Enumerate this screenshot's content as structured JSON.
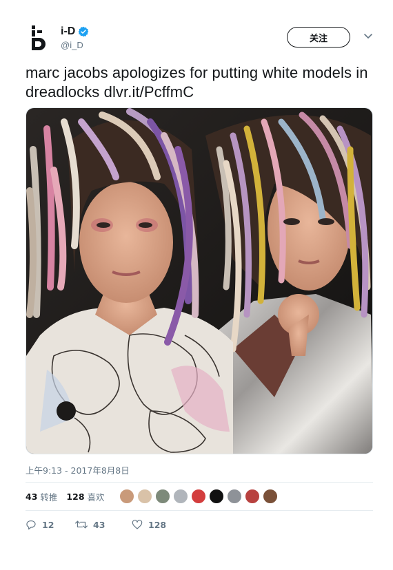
{
  "account": {
    "display_name": "i-D",
    "handle": "@i_D",
    "verified": true,
    "logo_glyph": "i-D wink logo",
    "follow_label": "关注"
  },
  "tweet": {
    "text": "marc jacobs apologizes for putting white models in dreadlocks dlvr.it/PcffmC",
    "image_alt": "photo of two models with multicolored yarn dreadlocks",
    "timestamp": "上午9:13 - 2017年8月8日"
  },
  "stats": {
    "retweets_count": "43",
    "retweets_label": "转推",
    "likes_count": "128",
    "likes_label": "喜欢"
  },
  "likers": [
    "#c99a7a",
    "#d9c2a8",
    "#7d8a7a",
    "#b0b5bb",
    "#d33d3d",
    "#111111",
    "#8e9298",
    "#b8413f",
    "#7a5038"
  ],
  "actions": {
    "reply_count": "12",
    "retweet_count": "43",
    "like_count": "128"
  },
  "colors": {
    "text": "#14171a",
    "secondary": "#657786",
    "verified": "#1da1f2",
    "divider": "#e6ecf0"
  },
  "icons": [
    "chevron-down-icon",
    "verified-badge-icon",
    "reply-icon",
    "retweet-icon",
    "heart-icon"
  ]
}
